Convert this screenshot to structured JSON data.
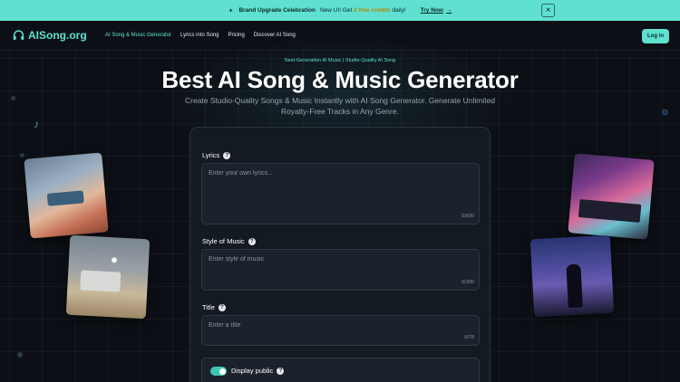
{
  "banner": {
    "title": "Brand Upgrade Celebration",
    "text_before": "New UI! Get",
    "credits": "2 free credits",
    "text_after": "daily!",
    "cta": "Try Now",
    "close_icon": "close-icon"
  },
  "nav": {
    "logo": "AISong.org",
    "links": [
      {
        "label": "AI Song & Music Generator",
        "active": true
      },
      {
        "label": "Lyrics into Song",
        "active": false
      },
      {
        "label": "Pricing",
        "active": false
      },
      {
        "label": "Discover AI Song",
        "active": false
      }
    ],
    "login": "Log in"
  },
  "hero": {
    "tagline": "Next-Generation AI Music | Studio-Quality AI Song",
    "title": "Best AI Song & Music Generator",
    "subtitle": "Create Studio-Quality Songs & Music Instantly with AI Song Generator. Generate Unlimited Royalty-Free Tracks in Any Genre."
  },
  "form": {
    "lyrics": {
      "label": "Lyrics",
      "placeholder": "Enter your own lyrics...",
      "counter": "0/600"
    },
    "style": {
      "label": "Style of Music",
      "placeholder": "Enter style of music",
      "counter": "0/300"
    },
    "title": {
      "label": "Title",
      "placeholder": "Enter a title",
      "counter": "0/78"
    },
    "display_public": {
      "label": "Display public",
      "enabled": true
    }
  },
  "colors": {
    "accent": "#5fe0d0",
    "background": "#0c1016",
    "card": "#141a21"
  }
}
